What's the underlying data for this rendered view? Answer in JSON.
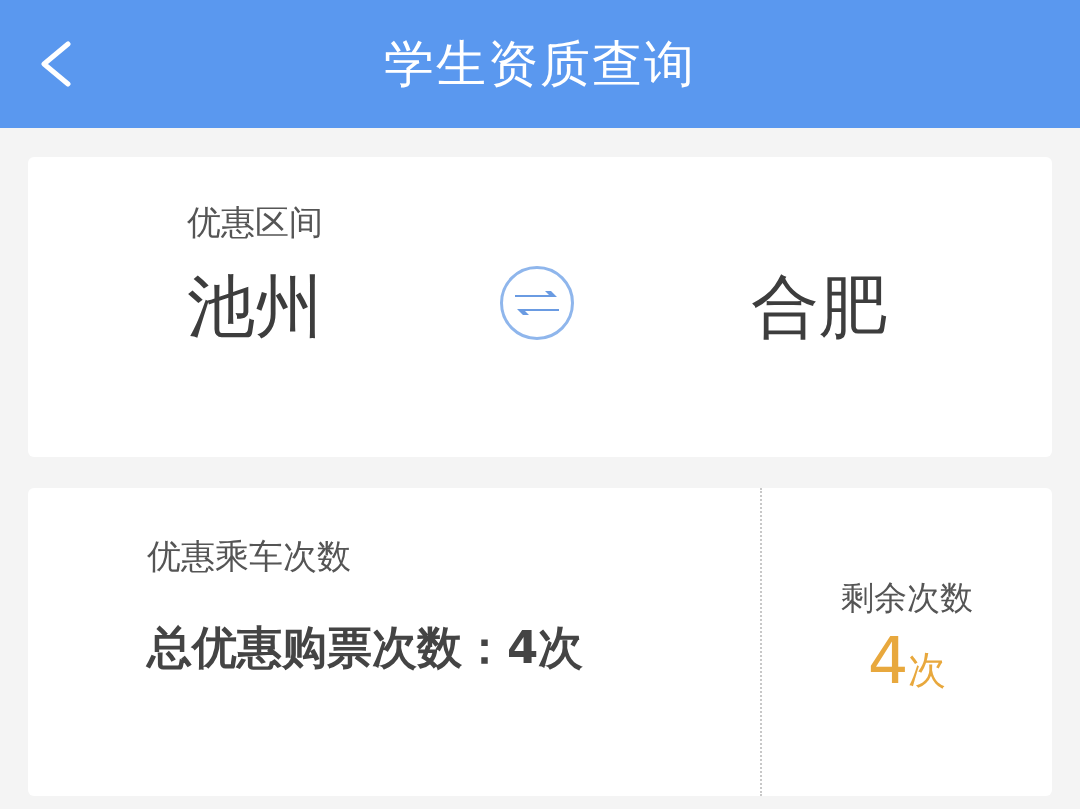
{
  "header": {
    "title": "学生资质查询"
  },
  "route": {
    "label": "优惠区间",
    "origin": "池州",
    "destination": "合肥"
  },
  "ride_count": {
    "label": "优惠乘车次数",
    "total": "总优惠购票次数：4次"
  },
  "remaining": {
    "label": "剩余次数",
    "number": "4",
    "unit": "次"
  }
}
